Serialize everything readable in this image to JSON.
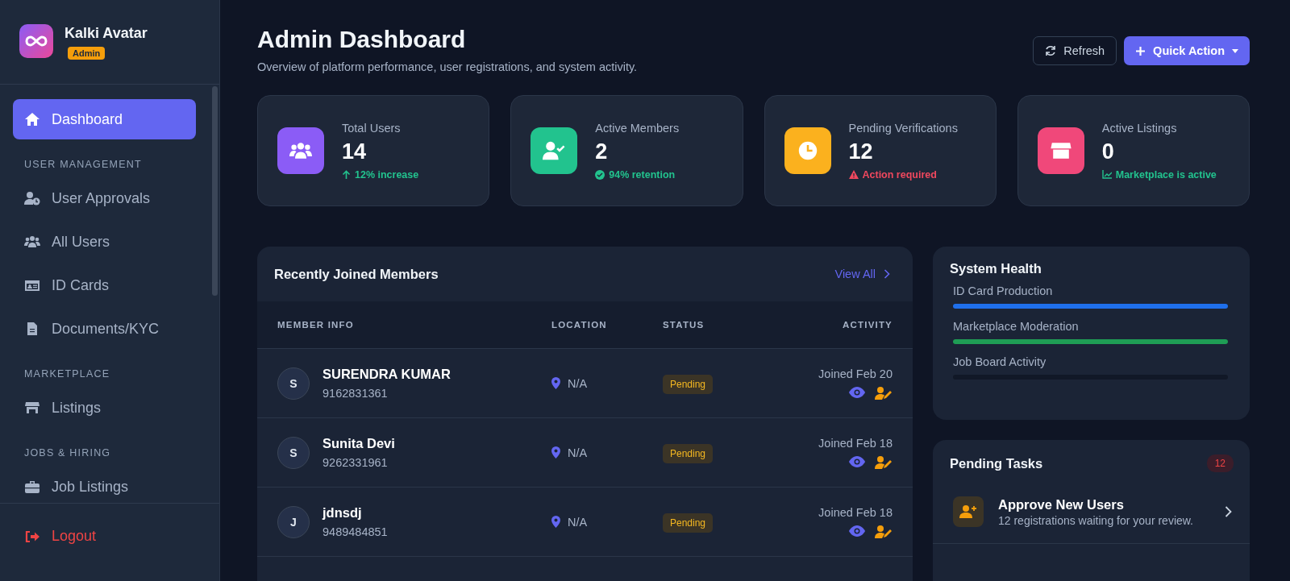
{
  "brand": {
    "name": "Kalki Avatar",
    "role": "Admin"
  },
  "sidebar": {
    "items": [
      {
        "kind": "item",
        "label": "Dashboard",
        "selected": true
      },
      {
        "kind": "section",
        "label": "USER MANAGEMENT"
      },
      {
        "kind": "item",
        "label": "User Approvals",
        "selected": false
      },
      {
        "kind": "item",
        "label": "All Users",
        "selected": false
      },
      {
        "kind": "item",
        "label": "ID Cards",
        "selected": false
      },
      {
        "kind": "item",
        "label": "Documents/KYC",
        "selected": false
      },
      {
        "kind": "section",
        "label": "MARKETPLACE"
      },
      {
        "kind": "item",
        "label": "Listings",
        "selected": false
      },
      {
        "kind": "section",
        "label": "JOBS & HIRING"
      },
      {
        "kind": "item",
        "label": "Job Listings",
        "selected": false
      }
    ],
    "logout": "Logout"
  },
  "header": {
    "title": "Admin Dashboard",
    "subtitle": "Overview of platform performance, user registrations, and system activity.",
    "buttons": [
      {
        "kind": "refresh",
        "label": "Refresh"
      },
      {
        "kind": "primary",
        "label": "Quick Action"
      }
    ]
  },
  "stats": [
    {
      "label": "Total Users",
      "value": "14",
      "note": "12% increase",
      "kind": "up",
      "color": "#8b5cf6"
    },
    {
      "label": "Active Members",
      "value": "2",
      "note": "94% retention",
      "kind": "check",
      "color": "#22c38e"
    },
    {
      "label": "Pending Verifications",
      "value": "12",
      "note": "Action required",
      "kind": "warn",
      "color": "#fbb11e"
    },
    {
      "label": "Active Listings",
      "value": "0",
      "note": "Marketplace is active",
      "kind": "trend",
      "color": "#f0487a"
    }
  ],
  "members": {
    "title": "Recently Joined Members",
    "link": "View All",
    "columns": [
      "MEMBER INFO",
      "LOCATION",
      "STATUS",
      "ACTIVITY"
    ],
    "rows": [
      {
        "initial": "S",
        "name": "SURENDRA KUMAR",
        "phone": "9162831361",
        "location": "N/A",
        "status": "Pending",
        "activity": "Joined Feb 20"
      },
      {
        "initial": "S",
        "name": "Sunita Devi",
        "phone": "9262331961",
        "location": "N/A",
        "status": "Pending",
        "activity": "Joined Feb 18"
      },
      {
        "initial": "J",
        "name": "jdnsdj",
        "phone": "9489484851",
        "location": "N/A",
        "status": "Pending",
        "activity": "Joined Feb 18"
      }
    ]
  },
  "health": {
    "title": "System Health",
    "bars": [
      {
        "label": "ID Card Production",
        "level": 1,
        "color": "#1f6feb"
      },
      {
        "label": "Marketplace Moderation",
        "level": 1,
        "color": "#1f9d55"
      },
      {
        "label": "Job Board Activity",
        "level": 0
      }
    ]
  },
  "tasks": {
    "title": "Pending Tasks",
    "count": "12",
    "items": [
      {
        "title": "Approve New Users",
        "description": "12 registrations waiting for your review."
      }
    ]
  }
}
